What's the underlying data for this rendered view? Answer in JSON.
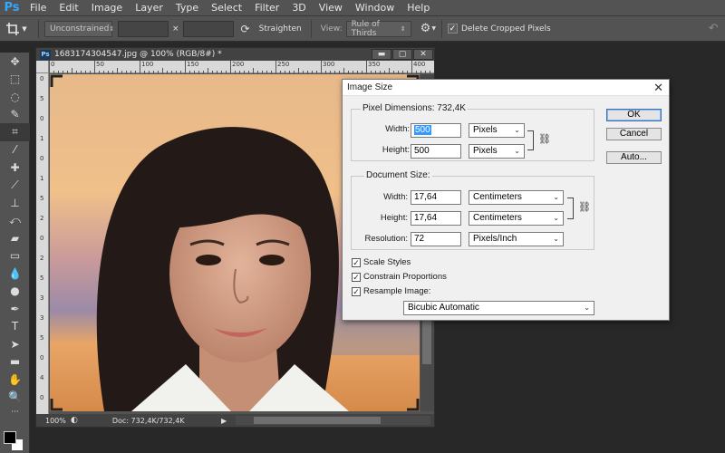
{
  "app": {
    "logo": "Ps"
  },
  "menu": [
    "File",
    "Edit",
    "Image",
    "Layer",
    "Type",
    "Select",
    "Filter",
    "3D",
    "View",
    "Window",
    "Help"
  ],
  "options": {
    "ratio": "Unconstrained",
    "times": "×",
    "straighten": "Straighten",
    "view_label": "View:",
    "view_value": "Rule of Thirds",
    "delete_cropped": "Delete Cropped Pixels"
  },
  "document": {
    "title": "1683174304547.jpg @ 100% (RGB/8#) *",
    "ruler_h": [
      "0",
      "50",
      "100",
      "150",
      "200",
      "250",
      "300",
      "350",
      "400"
    ],
    "ruler_v": [
      "0",
      "5",
      "0",
      "1",
      "0",
      "1",
      "5",
      "2",
      "0",
      "2",
      "5",
      "3",
      "3",
      "5",
      "0",
      "4",
      "0"
    ],
    "zoom": "100%",
    "doc_info": "Doc: 732,4K/732,4K"
  },
  "dialog": {
    "title": "Image Size",
    "pixel_dim_label": "Pixel Dimensions:",
    "pixel_dim_value": "732,4K",
    "width_label": "Width:",
    "width_value": "500",
    "width_unit": "Pixels",
    "height_label": "Height:",
    "height_value": "500",
    "height_unit": "Pixels",
    "doc_size_label": "Document Size:",
    "doc_width_label": "Width:",
    "doc_width_value": "17,64",
    "doc_width_unit": "Centimeters",
    "doc_height_label": "Height:",
    "doc_height_value": "17,64",
    "doc_height_unit": "Centimeters",
    "resolution_label": "Resolution:",
    "resolution_value": "72",
    "resolution_unit": "Pixels/Inch",
    "scale_styles": "Scale Styles",
    "constrain": "Constrain Proportions",
    "resample": "Resample Image:",
    "resample_method": "Bicubic Automatic",
    "ok": "OK",
    "cancel": "Cancel",
    "auto": "Auto..."
  }
}
